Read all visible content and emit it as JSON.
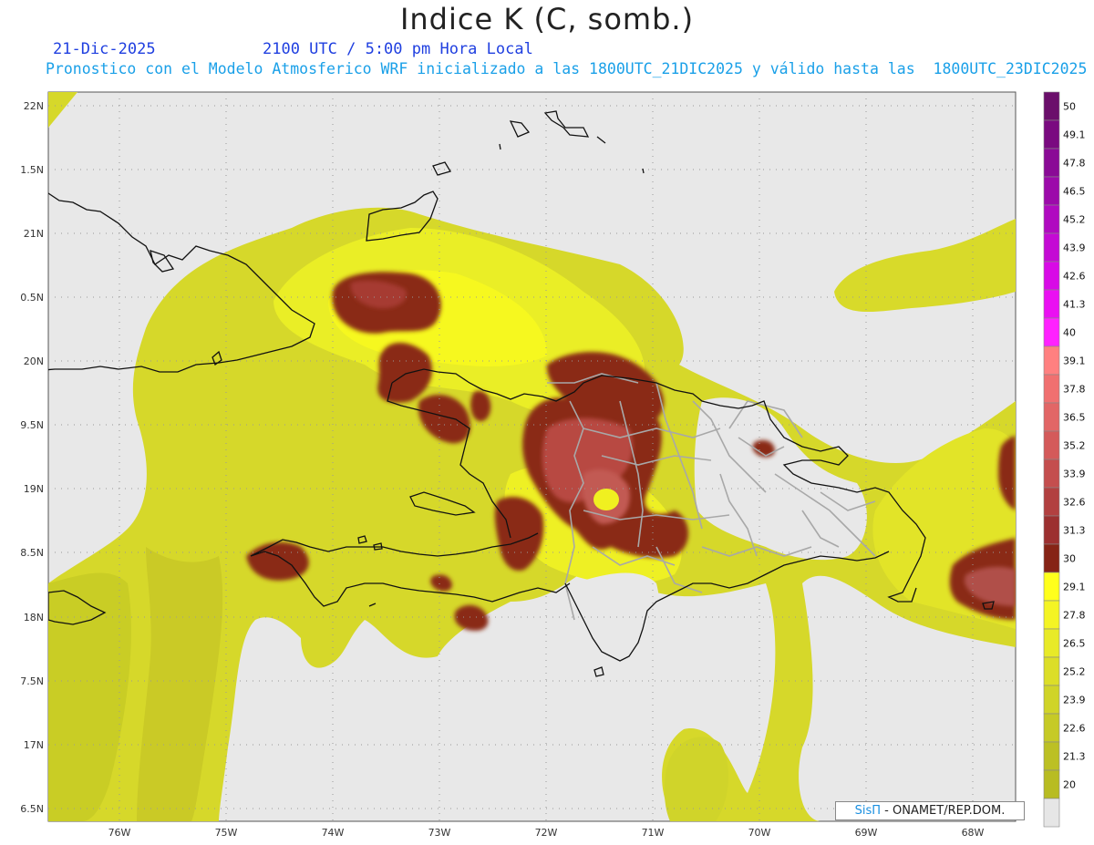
{
  "header": {
    "title": "Indice K (C, somb.)",
    "date": "21-Dic-2025",
    "time": "2100 UTC / 5:00 pm Hora Local",
    "description": "Pronostico con el Modelo Atmosferico WRF inicializado a las 1800UTC_21DIC2025 y válido hasta las  1800UTC_23DIC2025"
  },
  "map": {
    "lat_labels": [
      "22N",
      "1.5N",
      "21N",
      "0.5N",
      "20N",
      "9.5N",
      "19N",
      "8.5N",
      "18N",
      "7.5N",
      "17N",
      "6.5N"
    ],
    "lon_labels": [
      "76W",
      "75W",
      "74W",
      "73W",
      "72W",
      "71W",
      "70W",
      "69W",
      "68W"
    ],
    "background_color": "#e8e8e8",
    "coastline_color": "#111111",
    "province_border_color": "#a8a8a8"
  },
  "colorbar": {
    "levels": [
      {
        "label": "50",
        "color": "#6b0f6b"
      },
      {
        "label": "49.1",
        "color": "#7a0a80"
      },
      {
        "label": "47.8",
        "color": "#8a0a96"
      },
      {
        "label": "46.5",
        "color": "#9c0aaa"
      },
      {
        "label": "45.2",
        "color": "#b00ac0"
      },
      {
        "label": "43.9",
        "color": "#c40ad4"
      },
      {
        "label": "42.6",
        "color": "#d80ae6"
      },
      {
        "label": "41.3",
        "color": "#ea10f2"
      },
      {
        "label": "40",
        "color": "#ff22ff"
      },
      {
        "label": "39.1",
        "color": "#ff8080"
      },
      {
        "label": "37.8",
        "color": "#f07070"
      },
      {
        "label": "36.5",
        "color": "#e26666"
      },
      {
        "label": "35.2",
        "color": "#d45a5a"
      },
      {
        "label": "33.9",
        "color": "#c44e4e"
      },
      {
        "label": "32.6",
        "color": "#b24040"
      },
      {
        "label": "31.3",
        "color": "#9c3030"
      },
      {
        "label": "30",
        "color": "#862416"
      },
      {
        "label": "29.1",
        "color": "#ffff1c"
      },
      {
        "label": "27.8",
        "color": "#f4f424"
      },
      {
        "label": "26.5",
        "color": "#e8ea28"
      },
      {
        "label": "25.2",
        "color": "#dcde28"
      },
      {
        "label": "23.9",
        "color": "#d0d428"
      },
      {
        "label": "22.6",
        "color": "#c6ca26"
      },
      {
        "label": "21.3",
        "color": "#bcc024"
      },
      {
        "label": "20",
        "color": "#b8bc22"
      },
      {
        "label": "",
        "color": "#e6e6e6"
      }
    ]
  },
  "credit": {
    "brand": "SisΠ",
    "text": "- ONAMET/REP.DOM."
  }
}
